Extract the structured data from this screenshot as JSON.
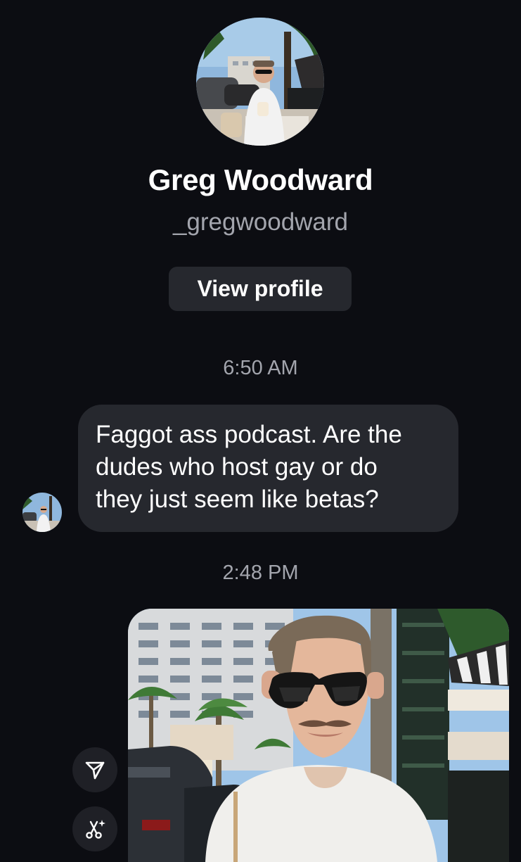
{
  "contact": {
    "name": "Greg Woodward",
    "handle": "_gregwoodward",
    "view_profile_label": "View profile"
  },
  "messages": [
    {
      "timestamp": "6:50 AM",
      "text_lines": [
        "Faggot ass podcast. Are the",
        "dudes who host gay or do",
        "they just seem like betas?"
      ]
    },
    {
      "timestamp": "2:48 PM",
      "attachment": "photo"
    }
  ],
  "actions": {
    "share_icon": "share-icon",
    "remix_icon": "ai-remix-icon"
  },
  "colors": {
    "background": "#0c0d12",
    "bubble": "#26282e",
    "secondary_text": "#a3a5ad"
  }
}
